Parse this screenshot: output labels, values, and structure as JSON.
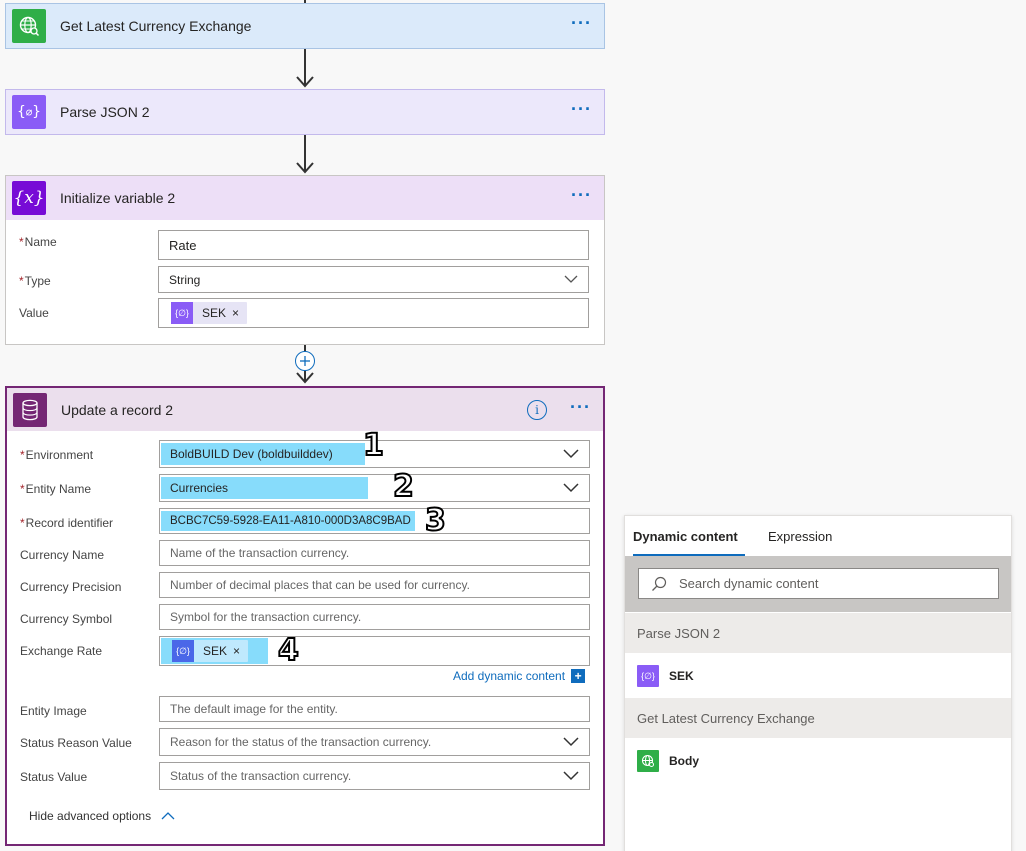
{
  "cards": {
    "currency": {
      "title": "Get Latest Currency Exchange",
      "menu_label": "···"
    },
    "parse": {
      "title": "Parse JSON 2",
      "menu_label": "···"
    },
    "init": {
      "title": "Initialize variable 2",
      "menu_label": "···",
      "name_label": "Name",
      "name_value": "Rate",
      "type_label": "Type",
      "type_value": "String",
      "value_label": "Value",
      "value_token": "SEK",
      "token_close": "×"
    },
    "update": {
      "title": "Update a record 2",
      "menu_label": "···",
      "info_label": "i",
      "fields": {
        "environment": {
          "label": "Environment",
          "value": "BoldBUILD Dev (boldbuilddev)"
        },
        "entity_name": {
          "label": "Entity Name",
          "value": "Currencies"
        },
        "record_identifier": {
          "label": "Record identifier",
          "value": "BCBC7C59-5928-EA11-A810-000D3A8C9BAD"
        },
        "currency_name": {
          "label": "Currency Name",
          "placeholder": "Name of the transaction currency."
        },
        "currency_precision": {
          "label": "Currency Precision",
          "placeholder": "Number of decimal places that can be used for currency."
        },
        "currency_symbol": {
          "label": "Currency Symbol",
          "placeholder": "Symbol for the transaction currency."
        },
        "exchange_rate": {
          "label": "Exchange Rate",
          "token": "SEK",
          "token_close": "×"
        },
        "entity_image": {
          "label": "Entity Image",
          "placeholder": "The default image for the entity."
        },
        "status_reason": {
          "label": "Status Reason Value",
          "placeholder": "Reason for the status of the transaction currency."
        },
        "status_value": {
          "label": "Status Value",
          "placeholder": "Status of the transaction currency."
        }
      },
      "add_dynamic_content": "Add dynamic content",
      "add_dynamic_plus": "+",
      "hide_advanced": "Hide advanced options"
    }
  },
  "required_mark": "*",
  "annotations": [
    "1",
    "2",
    "3",
    "4"
  ],
  "dynamic_panel": {
    "tabs": [
      "Dynamic content",
      "Expression"
    ],
    "search_placeholder": "Search dynamic content",
    "sections": [
      {
        "title": "Parse JSON 2",
        "items": [
          "SEK"
        ]
      },
      {
        "title": "Get Latest Currency Exchange",
        "items": [
          "Body"
        ]
      }
    ]
  },
  "colors": {
    "currency_header": "#dbeafa",
    "parse_header": "#ece8fb",
    "init_header": "#eddff7",
    "update_header": "#ebdfed",
    "update_border": "#742774",
    "highlight": "#87dcfb",
    "link": "#0f6cbd"
  }
}
